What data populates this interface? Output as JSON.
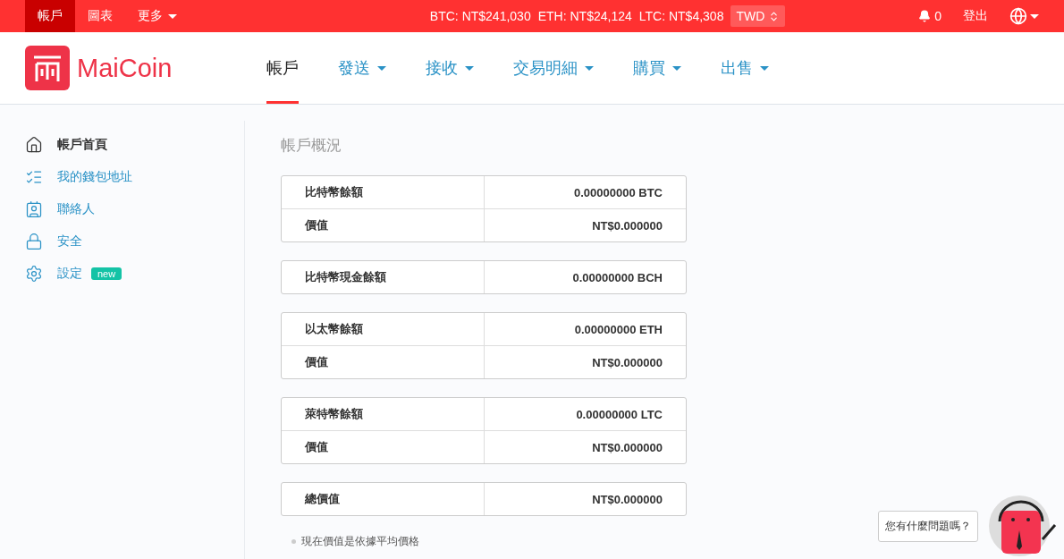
{
  "top_bar": {
    "menu": [
      {
        "label": "帳戶",
        "selected": true,
        "caret": false
      },
      {
        "label": "圖表",
        "selected": false,
        "caret": false
      },
      {
        "label": "更多",
        "selected": false,
        "caret": true
      }
    ],
    "prices": [
      "BTC: NT$241,030",
      "ETH: NT$24,124",
      "LTC: NT$4,308"
    ],
    "currency": "TWD",
    "notifications": "0",
    "logout": "登出"
  },
  "header": {
    "logo": "MaiCoin",
    "nav": [
      {
        "label": "帳戶",
        "selected": true,
        "caret": false
      },
      {
        "label": "發送",
        "selected": false,
        "caret": true
      },
      {
        "label": "接收",
        "selected": false,
        "caret": true
      },
      {
        "label": "交易明細",
        "selected": false,
        "caret": true
      },
      {
        "label": "購買",
        "selected": false,
        "caret": true
      },
      {
        "label": "出售",
        "selected": false,
        "caret": true
      }
    ]
  },
  "sidebar": {
    "items": [
      {
        "kind": "home",
        "label": "帳戶首頁",
        "selected": true
      },
      {
        "kind": "list",
        "label": "我的錢包地址",
        "selected": false
      },
      {
        "kind": "contact",
        "label": "聯絡人",
        "selected": false
      },
      {
        "kind": "lock",
        "label": "安全",
        "selected": false
      },
      {
        "kind": "settings",
        "label": "設定",
        "selected": false,
        "badge": "new"
      }
    ]
  },
  "main": {
    "title": "帳戶概況",
    "tables": [
      {
        "rows": [
          [
            "比特幣餘額",
            "0.00000000 BTC"
          ],
          [
            "價值",
            "NT$0.000000"
          ]
        ]
      },
      {
        "rows": [
          [
            "比特幣現金餘額",
            "0.00000000 BCH"
          ]
        ]
      },
      {
        "rows": [
          [
            "以太幣餘額",
            "0.00000000 ETH"
          ],
          [
            "價值",
            "NT$0.000000"
          ]
        ]
      },
      {
        "rows": [
          [
            "萊特幣餘額",
            "0.00000000 LTC"
          ],
          [
            "價值",
            "NT$0.000000"
          ]
        ]
      },
      {
        "rows": [
          [
            "總價值",
            "NT$0.000000"
          ]
        ]
      }
    ],
    "note": "現在價值是依據平均價格"
  },
  "chat": {
    "prompt": "您有什麼問題嗎？"
  }
}
